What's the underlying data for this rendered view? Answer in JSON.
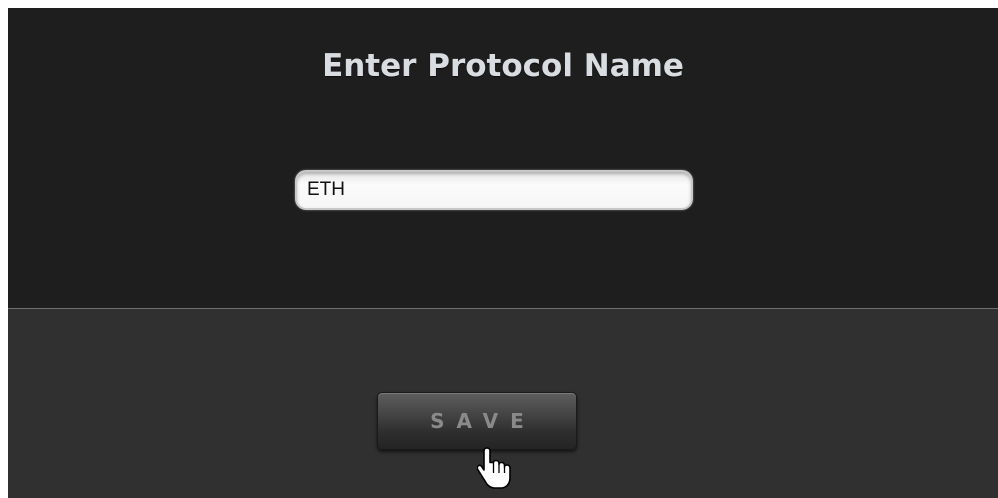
{
  "dialog": {
    "title": "Enter Protocol Name"
  },
  "protocol_input": {
    "value": "ETH"
  },
  "actions": {
    "save_label": "SAVE"
  },
  "cursor": {
    "icon": "hand-pointer-icon"
  },
  "colors": {
    "top_panel": "#1e1e1e",
    "bottom_panel": "#303030",
    "title_text": "#d9dde2",
    "button_text": "#8a8a8a"
  }
}
